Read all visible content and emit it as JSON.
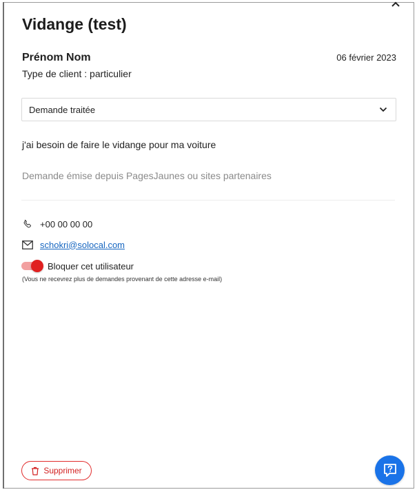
{
  "title": "Vidange (test)",
  "customer": {
    "name": "Prénom Nom",
    "date": "06 février 2023",
    "client_type": "Type de client : particulier"
  },
  "status": {
    "selected": "Demande traitée",
    "icon": "chevron-down-icon"
  },
  "message": "j'ai besoin de faire le vidange pour ma voiture",
  "source": "Demande émise depuis PagesJaunes ou sites partenaires",
  "contact": {
    "phone": "+00 00 00 00",
    "email": "schokri@solocal.com"
  },
  "block": {
    "label": "Bloquer cet utilisateur",
    "hint": "(Vous ne recevrez plus de demandes provenant de cette adresse e-mail)",
    "enabled": true
  },
  "actions": {
    "delete_label": "Supprimer"
  },
  "colors": {
    "accent_red": "#e02020",
    "link_blue": "#1565c0",
    "fab_blue": "#1a73e8"
  }
}
